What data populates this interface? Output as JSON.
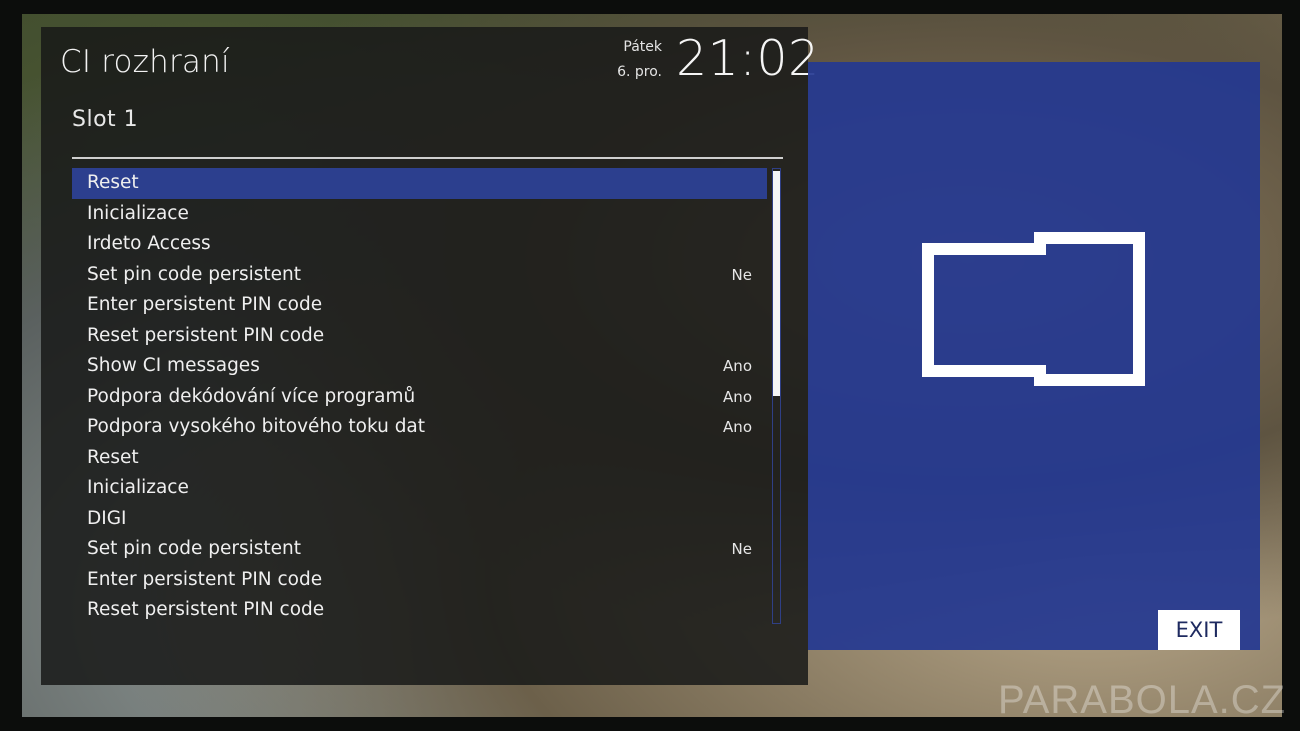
{
  "header": {
    "title": "CI rozhraní",
    "day": "Pátek",
    "date": "6. pro.",
    "time": "21:02"
  },
  "slot_label": "Slot  1",
  "menu": {
    "selected_index": 0,
    "items": [
      {
        "label": "Reset",
        "value": ""
      },
      {
        "label": "Inicializace",
        "value": ""
      },
      {
        "label": "Irdeto Access",
        "value": ""
      },
      {
        "label": "Set pin code persistent",
        "value": "Ne"
      },
      {
        "label": "Enter persistent PIN code",
        "value": ""
      },
      {
        "label": "Reset persistent PIN code",
        "value": ""
      },
      {
        "label": "Show CI messages",
        "value": "Ano"
      },
      {
        "label": "Podpora dekódování více programů",
        "value": "Ano"
      },
      {
        "label": "Podpora vysokého bitového toku dat",
        "value": "Ano"
      },
      {
        "label": "Reset",
        "value": ""
      },
      {
        "label": "Inicializace",
        "value": ""
      },
      {
        "label": "DIGI",
        "value": ""
      },
      {
        "label": "Set pin code persistent",
        "value": "Ne"
      },
      {
        "label": "Enter persistent PIN code",
        "value": ""
      },
      {
        "label": "Reset persistent PIN code",
        "value": ""
      }
    ]
  },
  "scrollbar": {
    "visible_fraction": 0.5,
    "position": 0
  },
  "preview": {
    "icon": "ci-card-icon",
    "exit_label": "EXIT"
  },
  "watermark": "PARABOLA.CZ",
  "colors": {
    "selection": "#2c3f8e",
    "preview_panel": "#24388f",
    "panel": "#181a18"
  }
}
